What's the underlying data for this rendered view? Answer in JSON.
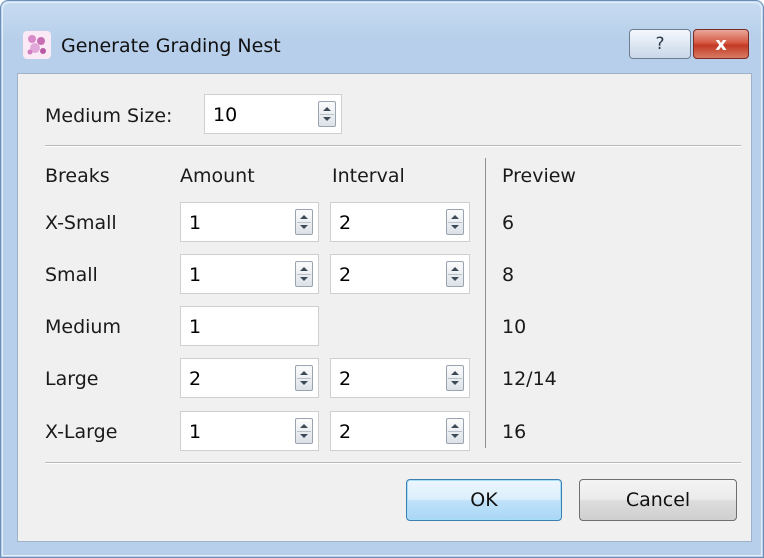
{
  "window": {
    "title": "Generate Grading Nest",
    "help_glyph": "?",
    "close_glyph": "x"
  },
  "medium_size": {
    "label": "Medium Size:",
    "value": "10"
  },
  "headers": {
    "breaks": "Breaks",
    "amount": "Amount",
    "interval": "Interval",
    "preview": "Preview"
  },
  "rows": [
    {
      "label": "X-Small",
      "amount": "1",
      "interval": "2",
      "preview": "6"
    },
    {
      "label": "Small",
      "amount": "1",
      "interval": "2",
      "preview": "8"
    },
    {
      "label": "Medium",
      "amount": "1",
      "interval": "",
      "preview": "10"
    },
    {
      "label": "Large",
      "amount": "2",
      "interval": "2",
      "preview": "12/14"
    },
    {
      "label": "X-Large",
      "amount": "1",
      "interval": "2",
      "preview": "16"
    }
  ],
  "buttons": {
    "ok": "OK",
    "cancel": "Cancel"
  },
  "colors": {
    "frame": "#b7cfea",
    "client": "#f0f0f0",
    "close": "#c33a25"
  }
}
